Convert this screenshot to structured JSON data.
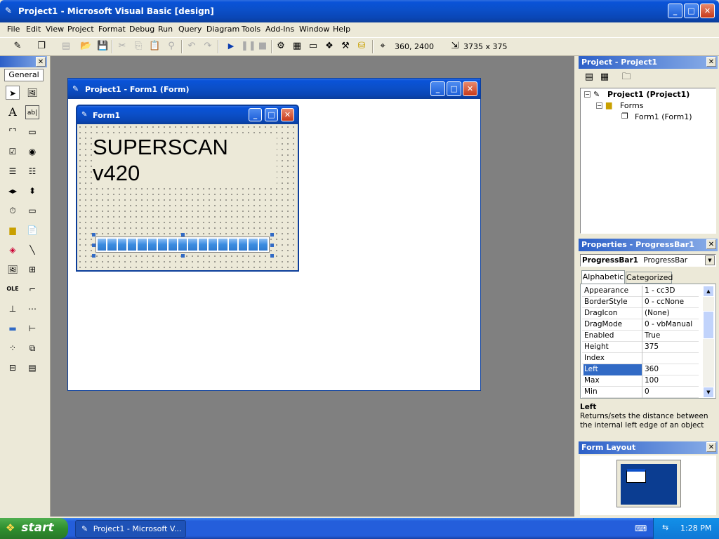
{
  "app": {
    "title": "Project1 - Microsoft Visual Basic [design]"
  },
  "menu": [
    {
      "label": "File"
    },
    {
      "label": "Edit"
    },
    {
      "label": "View"
    },
    {
      "label": "Project"
    },
    {
      "label": "Format"
    },
    {
      "label": "Debug"
    },
    {
      "label": "Run"
    },
    {
      "label": "Query"
    },
    {
      "label": "Diagram"
    },
    {
      "label": "Tools"
    },
    {
      "label": "Add-Ins"
    },
    {
      "label": "Window"
    },
    {
      "label": "Help"
    }
  ],
  "toolbar": {
    "position": "360, 2400",
    "size": "3735 x 375"
  },
  "toolbox": {
    "tab": "General"
  },
  "designer": {
    "title": "Project1 - Form1 (Form)",
    "form": {
      "title": "Form1",
      "label_line1": "SUPERSCAN",
      "label_line2": "v420",
      "progress_segments": 17
    }
  },
  "project_explorer": {
    "title": "Project - Project1",
    "root": "Project1 (Project1)",
    "folder": "Forms",
    "item": "Form1 (Form1)"
  },
  "properties": {
    "title": "Properties - ProgressBar1",
    "object_name": "ProgressBar1",
    "object_type": "ProgressBar",
    "tab_alpha": "Alphabetic",
    "tab_cat": "Categorized",
    "rows": [
      {
        "name": "Appearance",
        "value": "1 - cc3D"
      },
      {
        "name": "BorderStyle",
        "value": "0 - ccNone"
      },
      {
        "name": "DragIcon",
        "value": "(None)"
      },
      {
        "name": "DragMode",
        "value": "0 - vbManual"
      },
      {
        "name": "Enabled",
        "value": "True"
      },
      {
        "name": "Height",
        "value": "375"
      },
      {
        "name": "Index",
        "value": ""
      },
      {
        "name": "Left",
        "value": "360"
      },
      {
        "name": "Max",
        "value": "100"
      },
      {
        "name": "Min",
        "value": "0"
      }
    ],
    "desc_title": "Left",
    "desc_text": "Returns/sets the distance between the internal left edge of an object and the"
  },
  "form_layout": {
    "title": "Form Layout"
  },
  "taskbar": {
    "start": "start",
    "task": "Project1 - Microsoft V...",
    "clock": "1:28 PM"
  }
}
